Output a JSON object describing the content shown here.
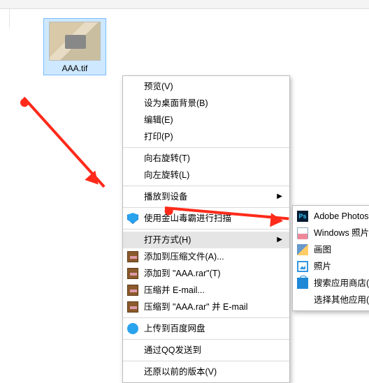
{
  "file": {
    "name": "AAA.tif"
  },
  "menu": {
    "preview": "预览(V)",
    "set_wallpaper": "设为桌面背景(B)",
    "edit": "编辑(E)",
    "print": "打印(P)",
    "rotate_right": "向右旋转(T)",
    "rotate_left": "向左旋转(L)",
    "cast_to_device": "播放到设备",
    "kingsoft_scan": "使用金山毒霸进行扫描",
    "open_with": "打开方式(H)",
    "add_to_archive": "添加到压缩文件(A)...",
    "add_to_rar": "添加到 \"AAA.rar\"(T)",
    "compress_email": "压缩并 E-mail...",
    "compress_rar_email": "压缩到 \"AAA.rar\" 并 E-mail",
    "upload_baidu": "上传到百度网盘",
    "qq_send": "通过QQ发送到",
    "restore_prev": "还原以前的版本(V)"
  },
  "submenu": {
    "photoshop": "Adobe Photoshop CC",
    "windows_photo_viewer": "Windows 照片查看器",
    "paint": "画图",
    "photos": "照片",
    "search_store": "搜索应用商店(S)",
    "choose_other": "选择其他应用(C)"
  }
}
